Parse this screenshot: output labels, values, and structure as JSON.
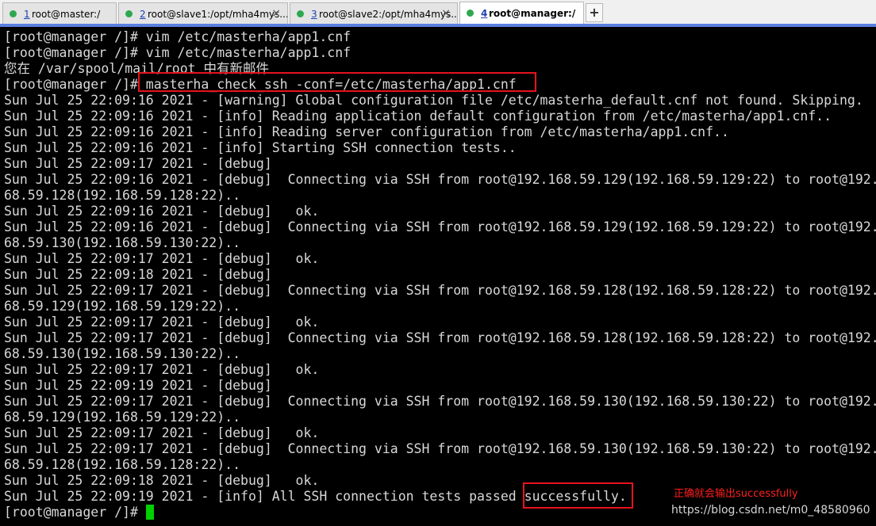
{
  "tabs": [
    {
      "number": "1",
      "title": "root@master:/",
      "status_color": "#2ea84f",
      "active": false
    },
    {
      "number": "2",
      "title": "root@slave1:/opt/mha4mys...",
      "status_color": "#2ea84f",
      "active": false
    },
    {
      "number": "3",
      "title": "root@slave2:/opt/mha4mys...",
      "status_color": "#2ea84f",
      "active": false
    },
    {
      "number": "4",
      "title": "root@manager:/",
      "status_color": "#2ea84f",
      "active": true
    }
  ],
  "tab_close_glyph": "×",
  "new_tab_glyph": "+",
  "terminal": {
    "lines": [
      "[root@manager /]# vim /etc/masterha/app1.cnf",
      "[root@manager /]# vim /etc/masterha/app1.cnf",
      "您在 /var/spool/mail/root 中有新邮件",
      "[root@manager /]# masterha_check_ssh -conf=/etc/masterha/app1.cnf",
      "Sun Jul 25 22:09:16 2021 - [warning] Global configuration file /etc/masterha_default.cnf not found. Skipping.",
      "Sun Jul 25 22:09:16 2021 - [info] Reading application default configuration from /etc/masterha/app1.cnf..",
      "Sun Jul 25 22:09:16 2021 - [info] Reading server configuration from /etc/masterha/app1.cnf..",
      "Sun Jul 25 22:09:16 2021 - [info] Starting SSH connection tests..",
      "Sun Jul 25 22:09:17 2021 - [debug]",
      "Sun Jul 25 22:09:16 2021 - [debug]  Connecting via SSH from root@192.168.59.129(192.168.59.129:22) to root@192.1",
      "68.59.128(192.168.59.128:22)..",
      "Sun Jul 25 22:09:16 2021 - [debug]   ok.",
      "Sun Jul 25 22:09:16 2021 - [debug]  Connecting via SSH from root@192.168.59.129(192.168.59.129:22) to root@192.1",
      "68.59.130(192.168.59.130:22)..",
      "Sun Jul 25 22:09:17 2021 - [debug]   ok.",
      "Sun Jul 25 22:09:18 2021 - [debug]",
      "Sun Jul 25 22:09:17 2021 - [debug]  Connecting via SSH from root@192.168.59.128(192.168.59.128:22) to root@192.1",
      "68.59.129(192.168.59.129:22)..",
      "Sun Jul 25 22:09:17 2021 - [debug]   ok.",
      "Sun Jul 25 22:09:17 2021 - [debug]  Connecting via SSH from root@192.168.59.128(192.168.59.128:22) to root@192.1",
      "68.59.130(192.168.59.130:22)..",
      "Sun Jul 25 22:09:17 2021 - [debug]   ok.",
      "Sun Jul 25 22:09:19 2021 - [debug]",
      "Sun Jul 25 22:09:17 2021 - [debug]  Connecting via SSH from root@192.168.59.130(192.168.59.130:22) to root@192.1",
      "68.59.129(192.168.59.129:22)..",
      "Sun Jul 25 22:09:17 2021 - [debug]   ok.",
      "Sun Jul 25 22:09:17 2021 - [debug]  Connecting via SSH from root@192.168.59.130(192.168.59.130:22) to root@192.1",
      "68.59.128(192.168.59.128:22)..",
      "Sun Jul 25 22:09:18 2021 - [debug]   ok.",
      "Sun Jul 25 22:09:19 2021 - [info] All SSH connection tests passed successfully.",
      "[root@manager /]# "
    ],
    "text_color": "#d8d8d8",
    "background": "#000000",
    "cursor_color": "#00d000"
  },
  "annotation": {
    "note": "正确就会输出successfully",
    "box_color": "#e8121c"
  },
  "watermark": "https://blog.csdn.net/m0_48580960"
}
